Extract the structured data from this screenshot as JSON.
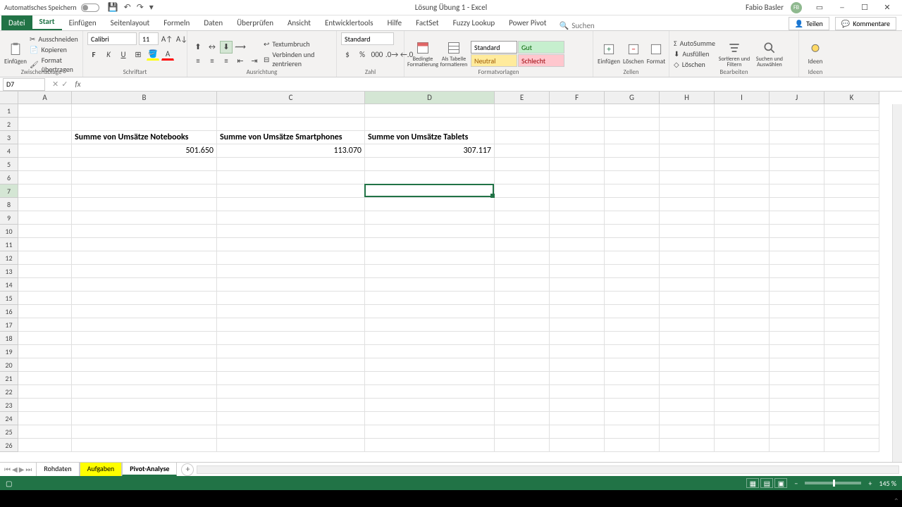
{
  "titlebar": {
    "autosave_label": "Automatisches Speichern",
    "doc_title": "Lösung Übung 1 - Excel",
    "user_name": "Fabio Basler",
    "user_initials": "FB"
  },
  "tabs": {
    "file": "Datei",
    "start": "Start",
    "einfuegen": "Einfügen",
    "seitenlayout": "Seitenlayout",
    "formeln": "Formeln",
    "daten": "Daten",
    "ueberpruefen": "Überprüfen",
    "ansicht": "Ansicht",
    "entwicklertools": "Entwicklertools",
    "hilfe": "Hilfe",
    "factset": "FactSet",
    "fuzzy": "Fuzzy Lookup",
    "powerpivot": "Power Pivot",
    "search_placeholder": "Suchen",
    "teilen": "Teilen",
    "kommentare": "Kommentare"
  },
  "ribbon": {
    "clipboard": {
      "paste": "Einfügen",
      "cut": "Ausschneiden",
      "copy": "Kopieren",
      "format_painter": "Format übertragen",
      "group": "Zwischenablage"
    },
    "font": {
      "name": "Calibri",
      "size": "11",
      "group": "Schriftart"
    },
    "alignment": {
      "wrap": "Textumbruch",
      "merge": "Verbinden und zentrieren",
      "group": "Ausrichtung"
    },
    "number": {
      "format": "Standard",
      "group": "Zahl"
    },
    "styles": {
      "cond": "Bedingte Formatierung",
      "table": "Als Tabelle formatieren",
      "std": "Standard",
      "gut": "Gut",
      "neu": "Neutral",
      "sch": "Schlecht",
      "group": "Formatvorlagen"
    },
    "cells": {
      "insert": "Einfügen",
      "delete": "Löschen",
      "format": "Format",
      "group": "Zellen"
    },
    "editing": {
      "sum": "AutoSumme",
      "fill": "Ausfüllen",
      "clear": "Löschen",
      "sort": "Sortieren und Filtern",
      "find": "Suchen und Auswählen",
      "group": "Bearbeiten"
    },
    "ideas": {
      "label": "Ideen",
      "group": "Ideen"
    }
  },
  "namebox": "D7",
  "columns": [
    "A",
    "B",
    "C",
    "D",
    "E",
    "F",
    "G",
    "H",
    "I",
    "J",
    "K"
  ],
  "selected_col": "D",
  "selected_row": 7,
  "cells": {
    "B3": "Summe von Umsätze Notebooks",
    "C3": "Summe von Umsätze Smartphones",
    "D3": "Summe von Umsätze Tablets",
    "B4": "501.650",
    "C4": "113.070",
    "D4": "307.117"
  },
  "sheets": {
    "rohdaten": "Rohdaten",
    "aufgaben": "Aufgaben",
    "pivot": "Pivot-Analyse"
  },
  "status": {
    "zoom": "145 %"
  }
}
